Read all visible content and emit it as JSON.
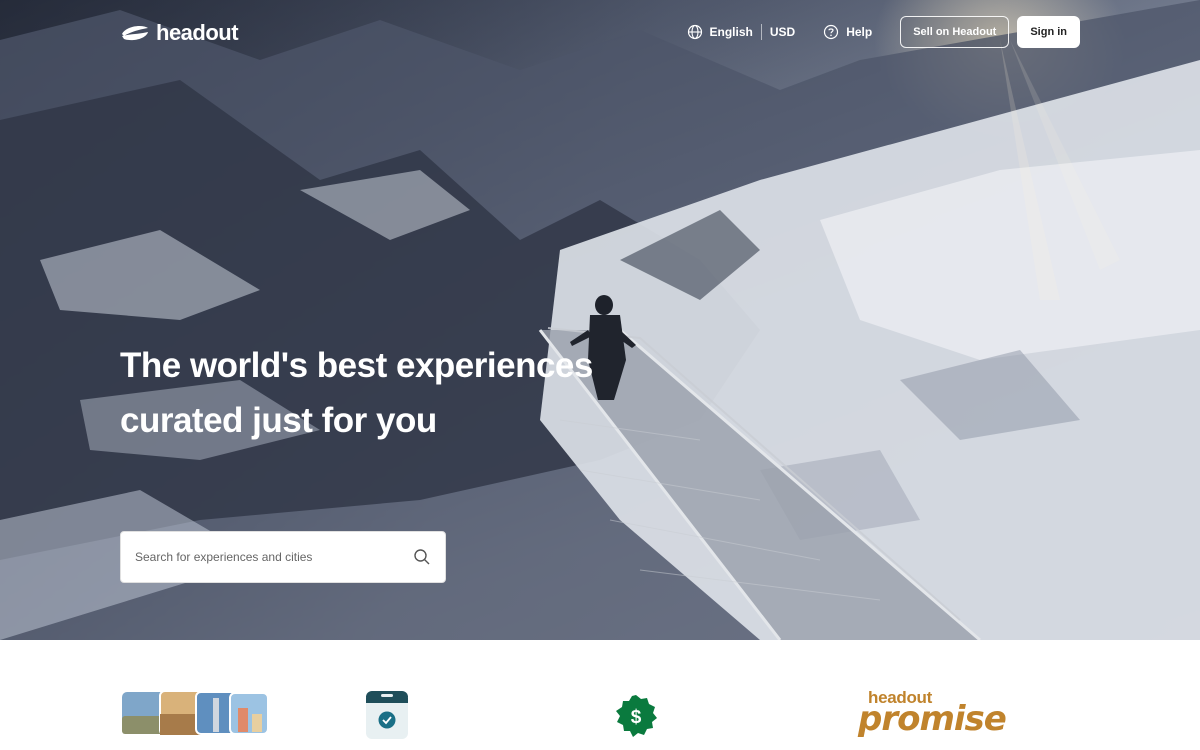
{
  "brand": {
    "name": "headout"
  },
  "nav": {
    "language": "English",
    "currency": "USD",
    "help_label": "Help",
    "sell_label": "Sell on Headout",
    "signin_label": "Sign in"
  },
  "hero": {
    "headline": "The world's best experiences curated just for you",
    "search_placeholder": "Search for experiences and cities"
  },
  "features": {
    "promise_brand": "headout",
    "promise_word": "promise"
  },
  "colors": {
    "promise_gold": "#c0832c",
    "money_green": "#0a7a3e",
    "calendar_teal": "#1f4e5a"
  },
  "icons": [
    "globe-icon",
    "help-icon",
    "search-icon",
    "calendar-check-icon",
    "dollar-badge-icon"
  ]
}
